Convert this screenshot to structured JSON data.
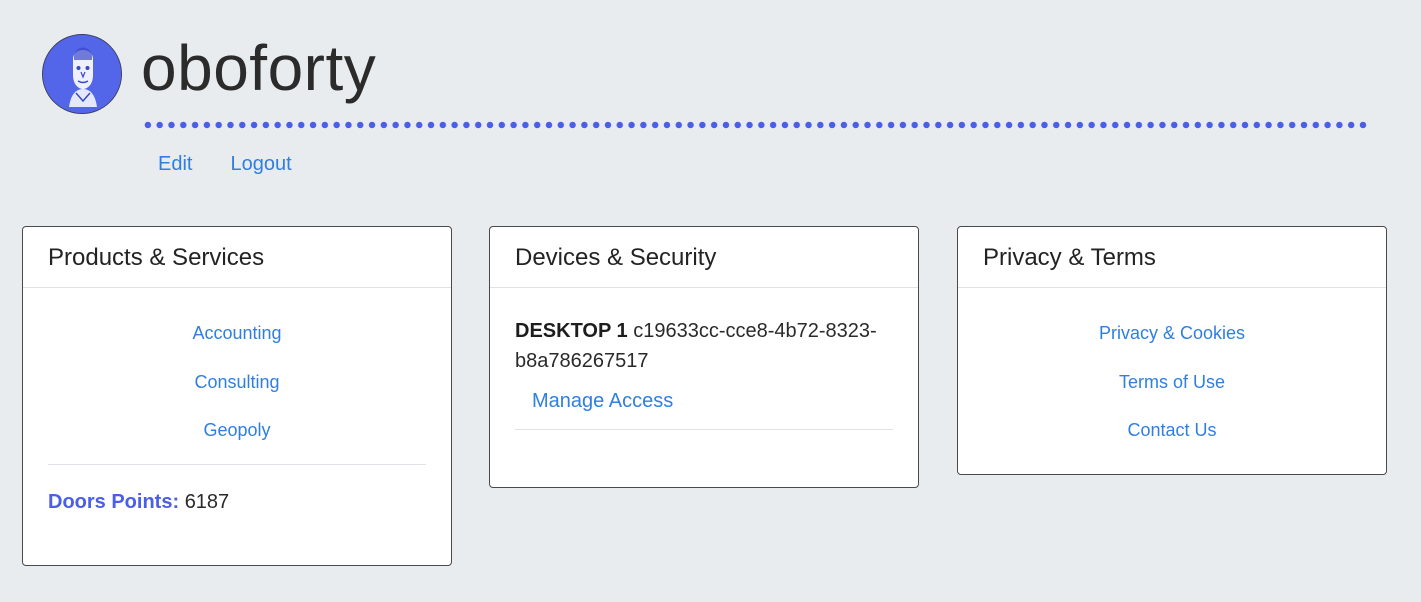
{
  "header": {
    "username": "oboforty",
    "nav": {
      "edit": "Edit",
      "logout": "Logout"
    },
    "accent_color": "#4a5ee8",
    "avatar_icon": "portrait-avatar-icon"
  },
  "products": {
    "title": "Products & Services",
    "links": [
      "Accounting",
      "Consulting",
      "Geopoly"
    ],
    "points_label": "Doors Points:",
    "points_value": "6187"
  },
  "devices": {
    "title": "Devices & Security",
    "device_name": "DESKTOP 1",
    "device_id": "c19633cc-cce8-4b72-8323-b8a786267517",
    "manage_label": "Manage Access"
  },
  "privacy": {
    "title": "Privacy & Terms",
    "links": [
      "Privacy & Cookies",
      "Terms of Use",
      "Contact Us"
    ]
  },
  "colors": {
    "background": "#e9ecef",
    "link": "#2f7fe0",
    "card_border": "#4a4a4a"
  }
}
